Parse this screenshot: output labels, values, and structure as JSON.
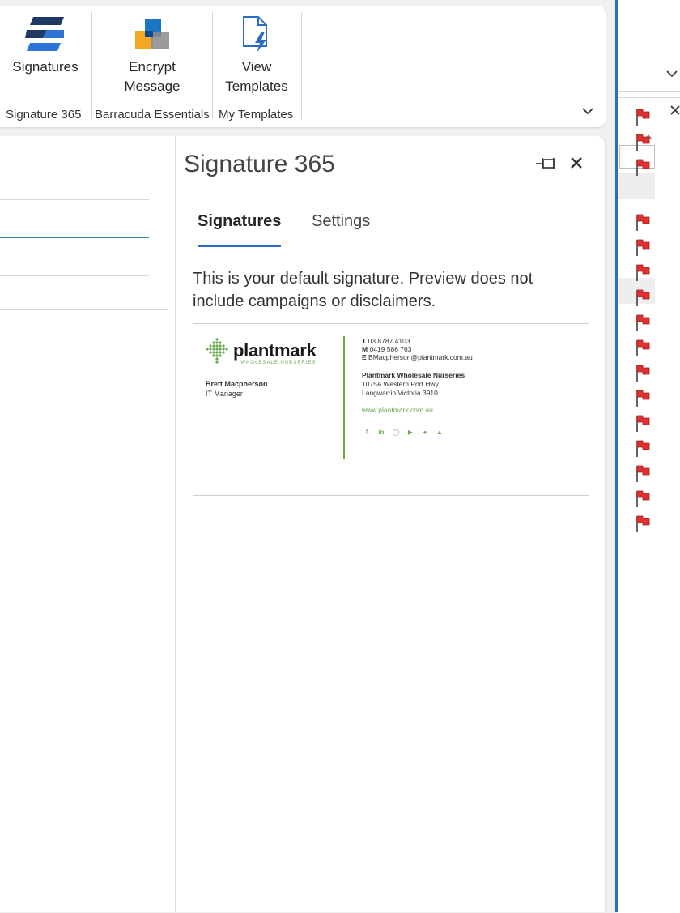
{
  "ribbon": {
    "buttons": {
      "signatures": "Signatures",
      "encrypt_line1": "Encrypt",
      "encrypt_line2": "Message",
      "view_line1": "View",
      "view_line2": "Templates"
    },
    "groups": {
      "signature365": "Signature 365",
      "barracuda": "Barracuda Essentials",
      "templates": "My Templates"
    },
    "icons": {
      "signatures": "signature365-logo-icon",
      "encrypt": "encrypt-message-icon",
      "view_templates": "template-lightning-icon",
      "collapse": "chevron-down-icon"
    }
  },
  "pane": {
    "title": "Signature 365",
    "tabs": [
      {
        "label": "Signatures",
        "active": true
      },
      {
        "label": "Settings",
        "active": false
      }
    ],
    "description": "This is your default signature. Preview does not include campaigns or disclaimers.",
    "accent_color": "#2b6cc4"
  },
  "signature": {
    "brand_name": "plantmark",
    "brand_sub": "WHOLESALE NURSERIES",
    "person_name": "Brett Macpherson",
    "person_title": "IT Manager",
    "phone_label": "T",
    "phone": "03 8787 4103",
    "mobile_label": "M",
    "mobile": "0419 586 763",
    "email_label": "E",
    "email": "BMacpherson@plantmark.com.au",
    "company": "Plantmark Wholesale Nurseries",
    "address1": "1075A Western Port Hwy",
    "address2": "Langwarrin Victoria 3910",
    "website": "www.plantmark.com.au",
    "social_icons": [
      "facebook-icon",
      "linkedin-icon",
      "instagram-icon",
      "youtube-icon",
      "apple-icon",
      "android-icon"
    ],
    "brand_color": "#6aa84f"
  },
  "right_strip": {
    "flag_count": 16,
    "flag_color": "#e03030"
  }
}
